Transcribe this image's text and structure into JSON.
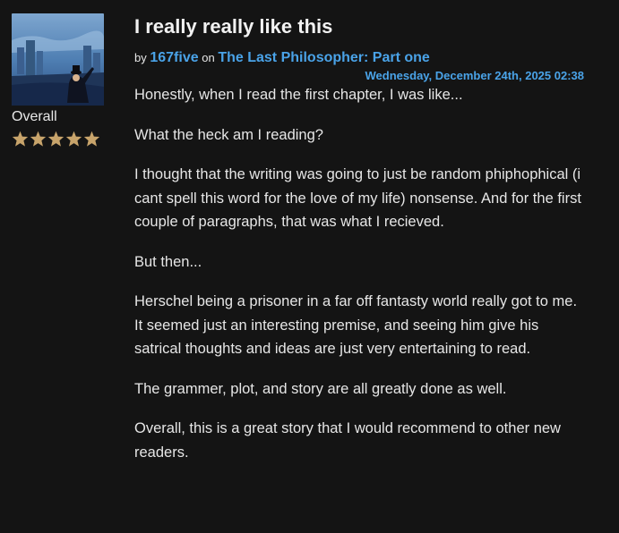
{
  "review": {
    "title": "I really really like this",
    "by_prefix": "by",
    "author": "167five",
    "on_prefix": "on",
    "chapter": "The Last Philosopher: Part one",
    "date": "Wednesday, December 24th, 2025 02:38",
    "rating_label": "Overall",
    "rating": {
      "value": 5,
      "max": 5
    },
    "star_color": "#c8a46b",
    "link_color": "#4aa3e8",
    "paragraphs": [
      "Honestly, when I read the first chapter, I was like...",
      "What the heck am I reading?",
      "I thought that the writing was going to just be random phiphophical (i cant spell this word for the love of my life) nonsense. And for the first couple of paragraphs, that was what I recieved.",
      "But then...",
      "Herschel being a prisoner in a far off fantasty world really got to me. It seemed just an interesting premise, and seeing him give his satrical thoughts and ideas are just very entertaining to read.",
      "The grammer, plot, and story are all greatly done as well.",
      "Overall, this is a great story that I would recommend to other new readers."
    ]
  }
}
